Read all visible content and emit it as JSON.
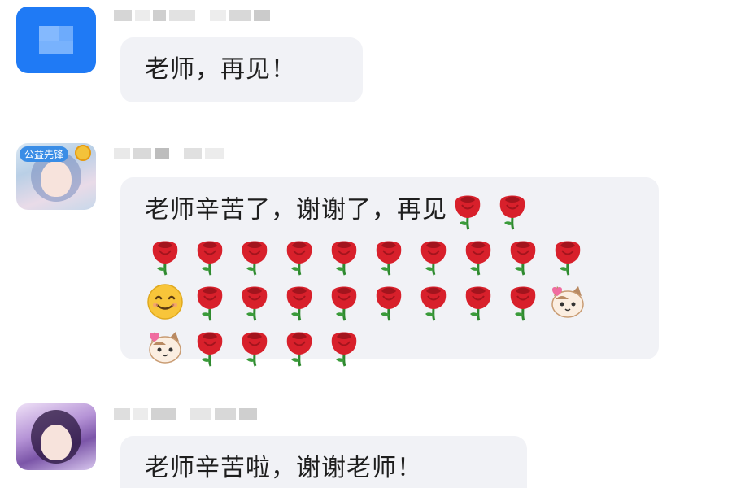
{
  "messages": [
    {
      "avatar": "blue-pixelated-avatar",
      "text": "老师，再见！"
    },
    {
      "avatar": "anime-girl-avatar",
      "avatar_badge": "公益先锋",
      "text": "老师辛苦了，谢谢了，再见",
      "emoji_rows": [
        [
          "rose",
          "rose"
        ],
        [
          "rose",
          "rose",
          "rose",
          "rose",
          "rose",
          "rose",
          "rose",
          "rose",
          "rose",
          "rose"
        ],
        [
          "smile",
          "rose",
          "rose",
          "rose",
          "rose",
          "rose",
          "rose",
          "rose",
          "rose",
          "cat"
        ],
        [
          "cat",
          "rose",
          "rose",
          "rose",
          "rose"
        ]
      ]
    },
    {
      "avatar": "purple-anime-avatar",
      "text": "老师辛苦啦，谢谢老师！"
    }
  ],
  "colors": {
    "bubble_bg": "#f1f2f6",
    "text": "#1e1e1e",
    "avatar_blue": "#1f7af5",
    "rose": "#d8202b"
  }
}
